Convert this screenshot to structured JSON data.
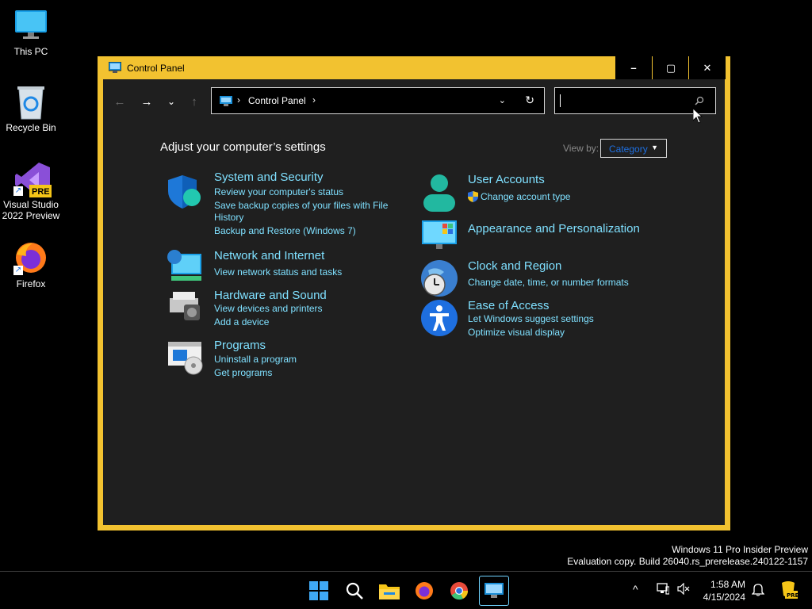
{
  "desktop": {
    "icons": [
      {
        "label": "This PC"
      },
      {
        "label": "Recycle Bin"
      },
      {
        "label": "Visual Studio 2022 Preview",
        "badge": "PRE"
      },
      {
        "label": "Firefox"
      }
    ]
  },
  "window": {
    "title": "Control Panel",
    "controls": {
      "minimize": "–",
      "maximize": "▢",
      "close": "✕"
    }
  },
  "toolbar": {
    "back": "←",
    "forward": "→",
    "recent": "⌄",
    "up": "↑",
    "breadcrumb": "Control Panel",
    "separator": "›",
    "dropdown": "⌄",
    "refresh": "↻",
    "search_placeholder": ""
  },
  "content": {
    "heading": "Adjust your computer’s settings",
    "view_by_label": "View by:",
    "view_by_value": "Category",
    "categories": [
      {
        "title": "System and Security",
        "links": [
          "Review your computer's status",
          "Save backup copies of your files with File",
          "History",
          "Backup and Restore (Windows 7)"
        ]
      },
      {
        "title": "Network and Internet",
        "links": [
          "View network status and tasks"
        ]
      },
      {
        "title": "Hardware and Sound",
        "links": [
          "View devices and printers",
          "Add a device"
        ]
      },
      {
        "title": "Programs",
        "links": [
          "Uninstall a program",
          "Get programs"
        ]
      },
      {
        "title": "User Accounts",
        "links": [
          "Change account type"
        ]
      },
      {
        "title": "Appearance and Personalization",
        "links": []
      },
      {
        "title": "Clock and Region",
        "links": [
          "Change date, time, or number formats"
        ]
      },
      {
        "title": "Ease of Access",
        "links": [
          "Let Windows suggest settings",
          "Optimize visual display"
        ]
      }
    ]
  },
  "watermark": {
    "line1": "Windows 11 Pro Insider Preview",
    "line2": "Evaluation copy. Build 26040.rs_prerelease.240122-1157"
  },
  "taskbar": {
    "time": "1:58 AM",
    "date": "4/15/2024",
    "tray_chevron": "^"
  },
  "colors": {
    "accent_border": "#f2c230",
    "link": "#7fe0ff",
    "selected": "#1e6fe0"
  }
}
